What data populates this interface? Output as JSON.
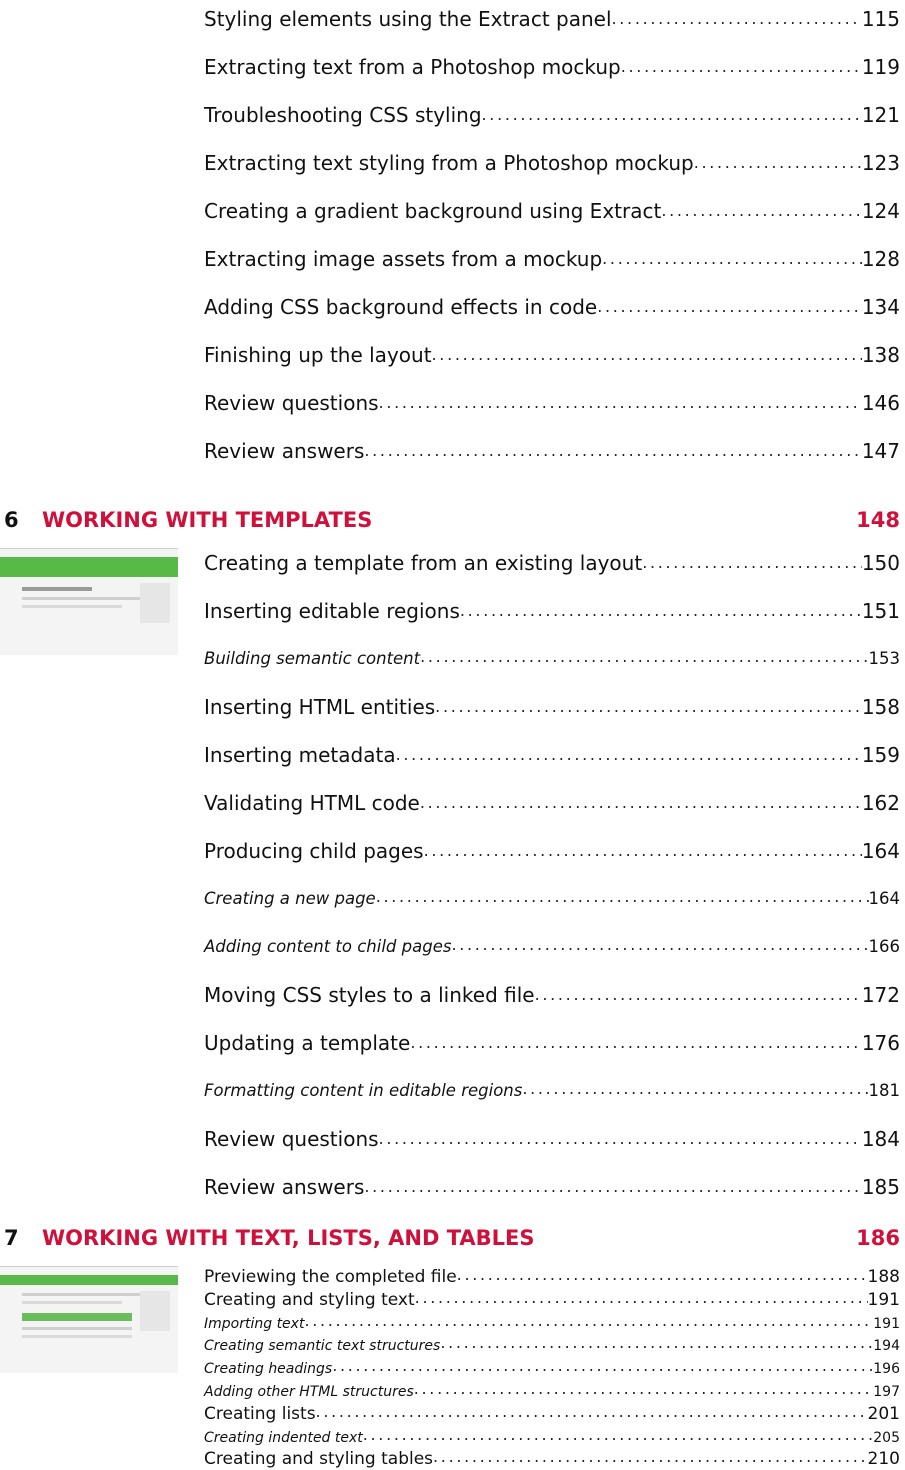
{
  "top_entries": [
    {
      "title": "Styling elements using the Extract panel",
      "page": "115"
    },
    {
      "title": "Extracting text from a Photoshop mockup",
      "page": "119"
    },
    {
      "title": "Troubleshooting CSS styling",
      "page": "121"
    },
    {
      "title": "Extracting text styling from a Photoshop mockup",
      "page": "123"
    },
    {
      "title": "Creating a gradient background using Extract",
      "page": "124"
    },
    {
      "title": "Extracting image assets from a mockup",
      "page": "128"
    },
    {
      "title": "Adding CSS background effects in code",
      "page": "134"
    },
    {
      "title": "Finishing up the layout",
      "page": "138"
    },
    {
      "title": "Review questions",
      "page": "146"
    },
    {
      "title": "Review answers",
      "page": "147"
    }
  ],
  "chapter6": {
    "number": "6",
    "title": "WORKING WITH TEMPLATES",
    "page": "148",
    "entries": [
      {
        "title": "Creating a template from an existing layout",
        "page": "150",
        "sub": false
      },
      {
        "title": "Inserting editable regions",
        "page": "151",
        "sub": false
      },
      {
        "title": "Building semantic content",
        "page": "153",
        "sub": true
      },
      {
        "title": "Inserting HTML entities",
        "page": "158",
        "sub": false
      },
      {
        "title": "Inserting metadata",
        "page": "159",
        "sub": false
      },
      {
        "title": "Validating HTML code",
        "page": "162",
        "sub": false
      },
      {
        "title": "Producing child pages",
        "page": "164",
        "sub": false
      },
      {
        "title": "Creating a new page",
        "page": "164",
        "sub": true
      },
      {
        "title": "Adding content to child pages",
        "page": "166",
        "sub": true
      },
      {
        "title": "Moving CSS styles to a linked file",
        "page": "172",
        "sub": false
      },
      {
        "title": "Updating a template",
        "page": "176",
        "sub": false
      },
      {
        "title": "Formatting content in editable regions",
        "page": "181",
        "sub": true
      },
      {
        "title": "Review questions",
        "page": "184",
        "sub": false
      },
      {
        "title": "Review answers",
        "page": "185",
        "sub": false
      }
    ]
  },
  "chapter7": {
    "number": "7",
    "title": "WORKING WITH TEXT, LISTS, AND TABLES",
    "page": "186",
    "entries": [
      {
        "title": "Previewing the completed file",
        "page": "188",
        "sub": false
      },
      {
        "title": "Creating and styling text",
        "page": "191",
        "sub": false
      },
      {
        "title": "Importing text",
        "page": "191",
        "sub": true
      },
      {
        "title": "Creating semantic text structures",
        "page": "194",
        "sub": true
      },
      {
        "title": "Creating headings",
        "page": "196",
        "sub": true
      },
      {
        "title": "Adding other HTML structures",
        "page": "197",
        "sub": true
      },
      {
        "title": "Creating lists",
        "page": "201",
        "sub": false
      },
      {
        "title": "Creating indented text",
        "page": "205",
        "sub": true
      },
      {
        "title": "Creating and styling tables",
        "page": "210",
        "sub": false
      }
    ]
  }
}
